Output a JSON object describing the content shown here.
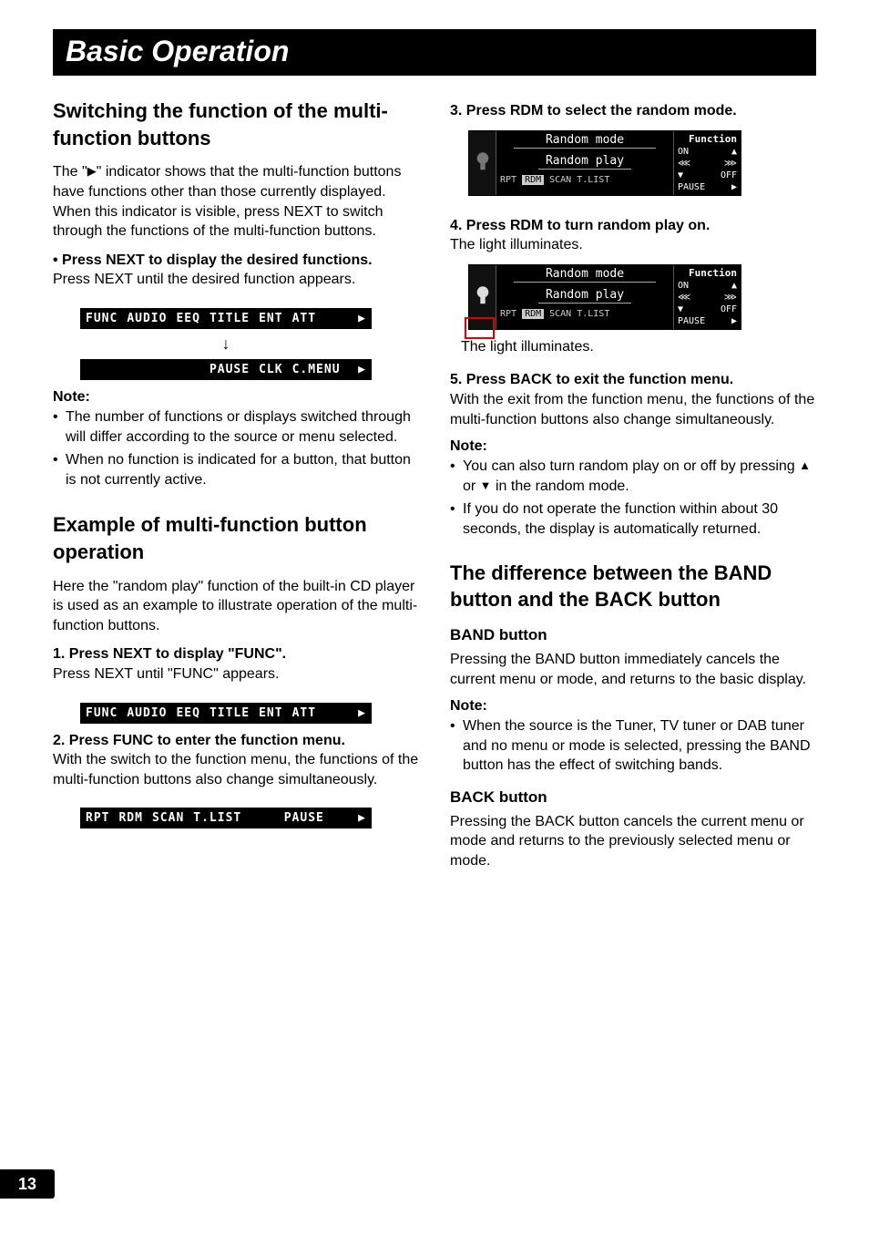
{
  "page_number": "13",
  "title_bar": "Basic Operation",
  "left": {
    "h1": "Switching the function of the multi-function buttons",
    "p1": "The \"3\" indicator shows that the multi-function buttons have functions other than those currently displayed. When this indicator is visible, press NEXT to switch through the functions of the multi-function buttons.",
    "step1_bold": "• Press NEXT to display the desired functions.",
    "step1_rest": "Press NEXT until the desired function appears.",
    "strip1": [
      "FUNC",
      "AUDIO",
      "EEQ",
      "TITLE",
      "ENT",
      "ATT"
    ],
    "strip1_arrow": "3",
    "strip2": [
      "",
      "",
      "",
      "PAUSE",
      "CLK",
      "C.MENU"
    ],
    "strip2_arrow": "3",
    "note_head": "Note:",
    "note1": "The number of functions or displays switched through will differ according to the source or menu selected.",
    "note2": "When no function is indicated for a button, that button is not currently active.",
    "h2": "Example of multi-function button operation",
    "p2": "Here the \"random play\" function of the built-in CD player is used as an example to illustrate operation of the multi-function buttons.",
    "s1_bold": "1. Press NEXT to display \"FUNC\".",
    "s1_rest": "Press NEXT until \"FUNC\" appears.",
    "strip3": [
      "FUNC",
      "AUDIO",
      "EEQ",
      "TITLE",
      "ENT",
      "ATT"
    ],
    "strip3_arrow": "3",
    "s2_bold": "2. Press FUNC to enter the function menu.",
    "s2_rest": "With the switch to the function menu, the functions of the multi-function buttons also change simultaneously.",
    "strip4": [
      "RPT",
      "RDM",
      "SCAN",
      "T.LIST",
      "",
      "PAUSE"
    ],
    "strip4_arrow": "3"
  },
  "right": {
    "s3_bold": "3. Press RDM to select the random mode.",
    "lcd1": {
      "title": "Random mode",
      "sub": "Random play",
      "foot": [
        "RPT",
        "RDM",
        "SCAN",
        "T.LIST"
      ],
      "hl": "RDM",
      "right_label": "Function",
      "on": "ON",
      "off": "OFF",
      "pause": "PAUSE",
      "arrow": "3"
    },
    "s4_bold": "4. Press RDM to turn random play on.",
    "s4_rest": "The light illuminates.",
    "lcd2": {
      "title": "Random mode",
      "sub": "Random play",
      "foot": [
        "RPT",
        "RDM",
        "SCAN",
        "T.LIST"
      ],
      "hl": "RDM",
      "right_label": "Function",
      "on": "ON",
      "off": "OFF",
      "pause": "PAUSE",
      "arrow": "3"
    },
    "caption": "The light illuminates.",
    "s5_bold": "5. Press BACK to exit the function menu.",
    "s5_rest": "With the exit from the function menu, the functions of the multi-function buttons also change simultaneously.",
    "note_head": "Note:",
    "note1": "You can also turn random play on or off by pressing 5 or ∞ in the random mode.",
    "note2": "If you do not operate the function within about 30 seconds, the display is automatically returned.",
    "h3": "The difference between the BAND button and the BACK button",
    "sub1": "BAND button",
    "sub1_body": "Pressing the BAND button immediately cancels the current menu or mode, and returns to the basic display.",
    "note2_head": "Note:",
    "note2_body": "When the source is the Tuner, TV tuner or DAB tuner and no menu or mode is selected, pressing the BAND button has the effect of switching bands.",
    "sub2": "BACK button",
    "sub2_body": "Pressing the BACK button cancels the current menu or mode and returns to the previously selected menu or mode."
  }
}
